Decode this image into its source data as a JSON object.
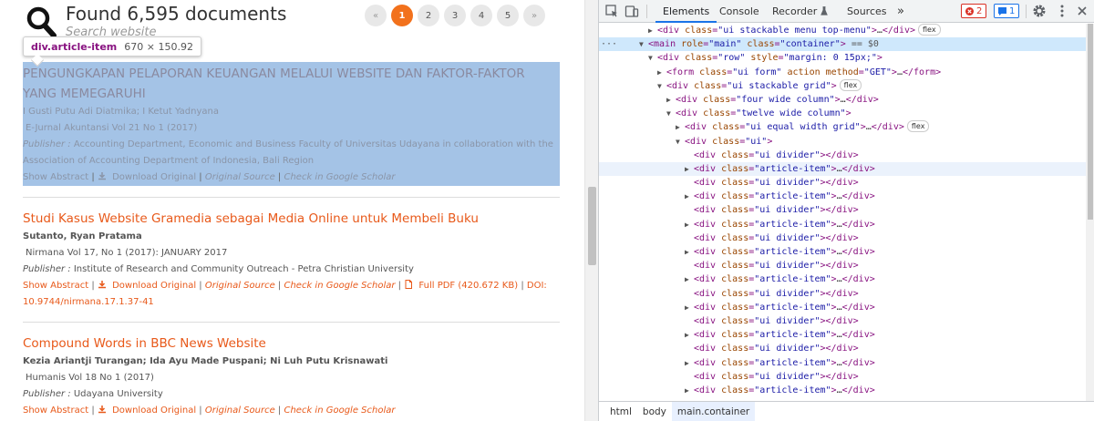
{
  "page": {
    "found_text": "Found 6,595 documents",
    "search_placeholder": "Search website",
    "pagination": {
      "prev": "«",
      "pages": [
        "1",
        "2",
        "3",
        "4",
        "5"
      ],
      "next": "»",
      "active": "1"
    },
    "tooltip": {
      "tag": "div.article-item",
      "dims": "670 × 150.92"
    },
    "articles": [
      {
        "title": "PENGUNGKAPAN PELAPORAN KEUANGAN MELALUI WEBSITE DAN FAKTOR-FAKTOR YANG MEMEGARUHI",
        "authors": "I Gusti Putu Adi Diatmika; I Ketut Yadnyana",
        "journal": "E-Jurnal Akuntansi Vol 21 No 1 (2017)",
        "publisher_label": "Publisher :",
        "publisher": "Accounting Department, Economic and Business Faculty of Universitas Udayana in collaboration with the Association of Accounting Department of Indonesia, Bali Region",
        "links": [
          "Show Abstract",
          "Download Original",
          "Original Source",
          "Check in Google Scholar"
        ]
      },
      {
        "title": "Studi Kasus Website Gramedia sebagai Media Online untuk Membeli Buku",
        "authors": "Sutanto, Ryan Pratama",
        "journal": "Nirmana Vol 17, No 1 (2017): JANUARY 2017",
        "publisher_label": "Publisher :",
        "publisher": "Institute of Research and Community Outreach - Petra Christian University",
        "links": [
          "Show Abstract",
          "Download Original",
          "Original Source",
          "Check in Google Scholar",
          "Full PDF (420.672 KB)",
          "DOI:"
        ],
        "doi": "10.9744/nirmana.17.1.37-41"
      },
      {
        "title": "Compound Words in BBC News Website",
        "authors": "Kezia Ariantji Turangan; Ida Ayu Made Puspani; Ni Luh Putu Krisnawati",
        "journal": "Humanis Vol 18 No 1 (2017)",
        "publisher_label": "Publisher :",
        "publisher": "Udayana University",
        "links": [
          "Show Abstract",
          "Download Original",
          "Original Source",
          "Check in Google Scholar"
        ]
      }
    ]
  },
  "devtools": {
    "tabs": [
      "Elements",
      "Console",
      "Recorder",
      "Sources",
      "»"
    ],
    "active_tab": "Elements",
    "errors": "2",
    "messages": "1",
    "breadcrumbs": [
      "html",
      "body",
      "main.container"
    ],
    "dom_lines": [
      {
        "indent": 4,
        "tri": "▶",
        "html": "<div class=\"ui stackable menu top-menu\">…</div>",
        "pill": "flex"
      },
      {
        "indent": 3,
        "tri": "▼",
        "html": "<main role=\"main\" class=\"container\">",
        "suffix": " == $0",
        "selected": true
      },
      {
        "indent": 4,
        "tri": "▼",
        "html": "<div class=\"row\" style=\"margin: 0 15px;\">"
      },
      {
        "indent": 5,
        "tri": "▶",
        "html": "<form class=\"ui form\" action method=\"GET\">…</form>"
      },
      {
        "indent": 5,
        "tri": "▼",
        "html": "<div class=\"ui stackable grid\">",
        "pill": "flex"
      },
      {
        "indent": 6,
        "tri": "▶",
        "html": "<div class=\"four wide column\">…</div>"
      },
      {
        "indent": 6,
        "tri": "▼",
        "html": "<div class=\"twelve wide column\">"
      },
      {
        "indent": 7,
        "tri": "▶",
        "html": "<div class=\"ui equal width grid\">…</div>",
        "pill": "flex"
      },
      {
        "indent": 7,
        "tri": "▼",
        "html": "<div class=\"ui\">"
      },
      {
        "indent": 8,
        "tri": "",
        "html": "<div class=\"ui divider\"></div>"
      },
      {
        "indent": 8,
        "tri": "▶",
        "html": "<div class=\"article-item\">…</div>",
        "hovered": true
      },
      {
        "indent": 8,
        "tri": "",
        "html": "<div class=\"ui divider\"></div>"
      },
      {
        "indent": 8,
        "tri": "▶",
        "html": "<div class=\"article-item\">…</div>"
      },
      {
        "indent": 8,
        "tri": "",
        "html": "<div class=\"ui divider\"></div>"
      },
      {
        "indent": 8,
        "tri": "▶",
        "html": "<div class=\"article-item\">…</div>"
      },
      {
        "indent": 8,
        "tri": "",
        "html": "<div class=\"ui divider\"></div>"
      },
      {
        "indent": 8,
        "tri": "▶",
        "html": "<div class=\"article-item\">…</div>"
      },
      {
        "indent": 8,
        "tri": "",
        "html": "<div class=\"ui divider\"></div>"
      },
      {
        "indent": 8,
        "tri": "▶",
        "html": "<div class=\"article-item\">…</div>"
      },
      {
        "indent": 8,
        "tri": "",
        "html": "<div class=\"ui divider\"></div>"
      },
      {
        "indent": 8,
        "tri": "▶",
        "html": "<div class=\"article-item\">…</div>"
      },
      {
        "indent": 8,
        "tri": "",
        "html": "<div class=\"ui divider\"></div>"
      },
      {
        "indent": 8,
        "tri": "▶",
        "html": "<div class=\"article-item\">…</div>"
      },
      {
        "indent": 8,
        "tri": "",
        "html": "<div class=\"ui divider\"></div>"
      },
      {
        "indent": 8,
        "tri": "▶",
        "html": "<div class=\"article-item\">…</div>"
      },
      {
        "indent": 8,
        "tri": "",
        "html": "<div class=\"ui divider\"></div>"
      },
      {
        "indent": 8,
        "tri": "▶",
        "html": "<div class=\"article-item\">…</div>"
      }
    ]
  },
  "colors": {
    "accent": "#f2711c",
    "link": "#e8591a",
    "highlight": "#a4c3e6",
    "devtools_selected": "#cfe8fc"
  },
  "icons": {
    "search": "search-icon",
    "download": "download-icon",
    "pdf": "pdf-icon",
    "inspect": "inspect-element-icon",
    "device": "device-toolbar-icon",
    "settings": "gear-icon",
    "more": "kebab-menu-icon"
  }
}
